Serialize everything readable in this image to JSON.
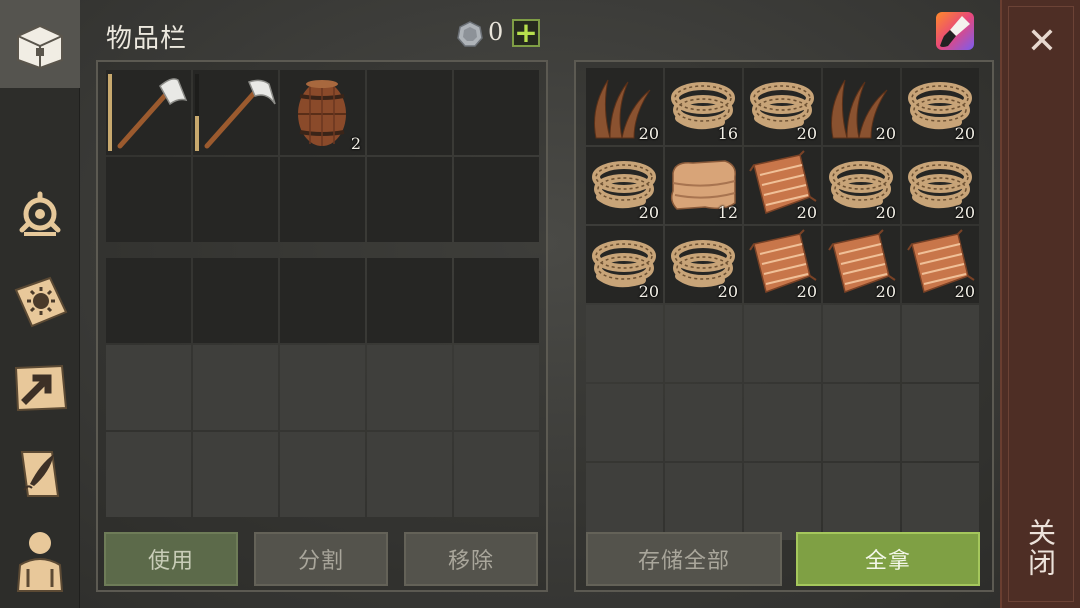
{
  "header": {
    "title": "物品栏",
    "coin_icon": "silver-coin-icon",
    "coin_count": "0",
    "add_label": "+",
    "brush_icon": "paintbrush-icon"
  },
  "sidebar": {
    "tabs": [
      {
        "name": "inventory-chest-icon",
        "active": true
      },
      {
        "name": "clan-symbol-icon",
        "active": false
      },
      {
        "name": "sun-book-icon",
        "active": false
      },
      {
        "name": "map-arrow-icon",
        "active": false
      },
      {
        "name": "quill-scroll-icon",
        "active": false
      },
      {
        "name": "character-icon",
        "active": false
      }
    ]
  },
  "inventory": {
    "quick_slots": [
      {
        "item": "hatchet-icon",
        "count": "",
        "durability": "full"
      },
      {
        "item": "pickaxe-icon",
        "count": "",
        "durability": "low"
      },
      {
        "item": "barrel-icon",
        "count": "2"
      },
      {
        "item": "",
        "count": ""
      },
      {
        "item": "",
        "count": ""
      }
    ]
  },
  "storage": {
    "items": [
      {
        "item": "plant-fiber-icon",
        "count": "20"
      },
      {
        "item": "rope-icon",
        "count": "16"
      },
      {
        "item": "rope-icon",
        "count": "20"
      },
      {
        "item": "plant-fiber-icon",
        "count": "20"
      },
      {
        "item": "rope-icon",
        "count": "20"
      },
      {
        "item": "rope-icon",
        "count": "20"
      },
      {
        "item": "cloth-icon",
        "count": "12"
      },
      {
        "item": "rag-icon",
        "count": "20"
      },
      {
        "item": "rope-icon",
        "count": "20"
      },
      {
        "item": "rope-icon",
        "count": "20"
      },
      {
        "item": "rope-icon",
        "count": "20"
      },
      {
        "item": "rope-icon",
        "count": "20"
      },
      {
        "item": "rag-icon",
        "count": "20"
      },
      {
        "item": "rag-icon",
        "count": "20"
      },
      {
        "item": "rag-icon",
        "count": "20"
      }
    ]
  },
  "buttons": {
    "use": "使用",
    "split": "分割",
    "remove": "移除",
    "store_all": "存储全部",
    "take_all": "全拿"
  },
  "close": {
    "icon": "close-icon",
    "label": "关闭"
  },
  "colors": {
    "accent_green": "#7fa044",
    "close_bar": "#4e2e25"
  }
}
